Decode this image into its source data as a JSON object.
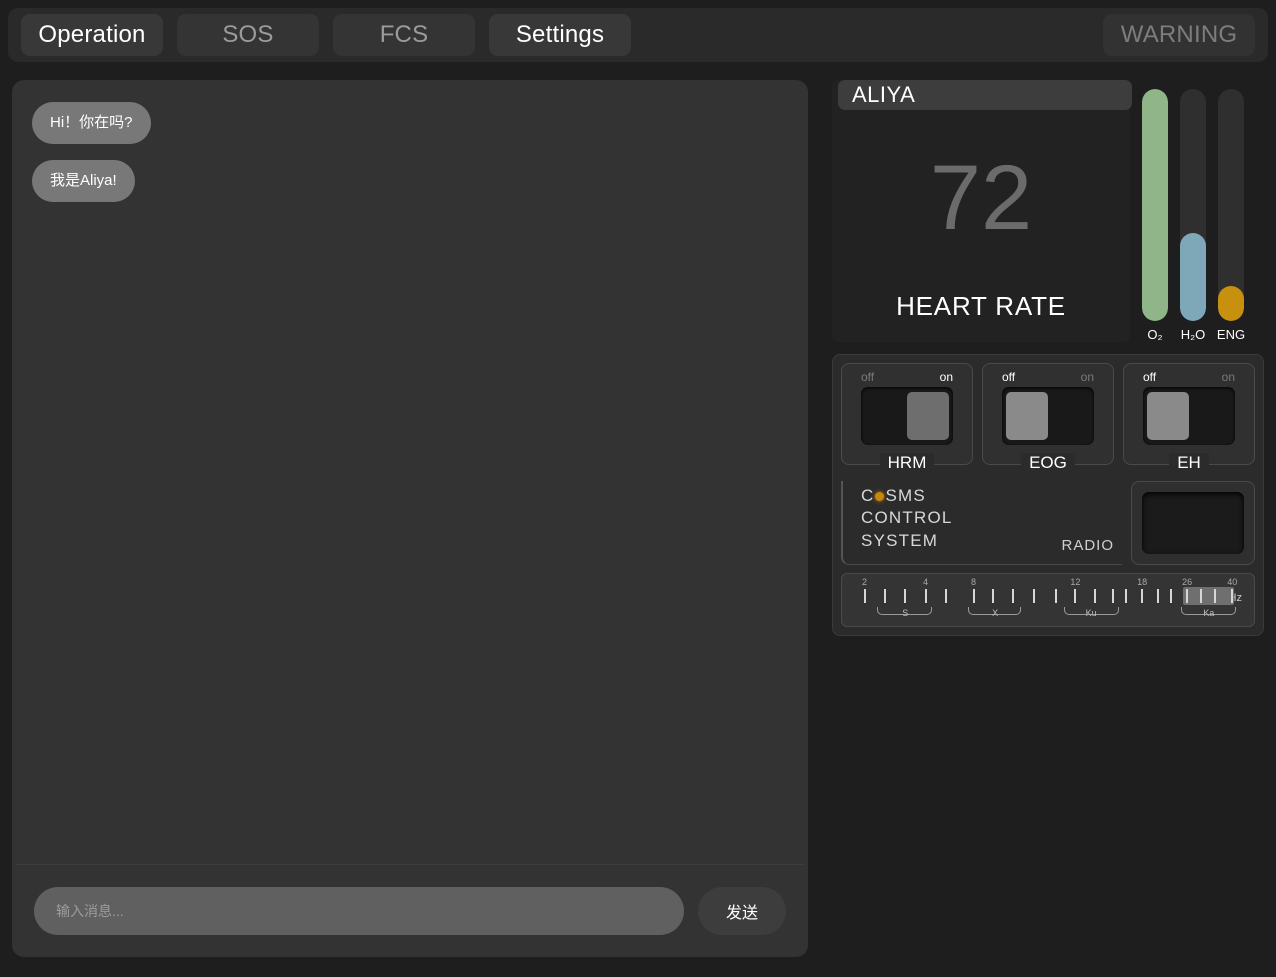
{
  "topbar": {
    "tabs": [
      {
        "label": "Operation",
        "state": "active"
      },
      {
        "label": "SOS",
        "state": "inactive"
      },
      {
        "label": "FCS",
        "state": "inactive"
      },
      {
        "label": "Settings",
        "state": "active"
      }
    ],
    "warning": {
      "label": "WARNING",
      "state": "inactive"
    }
  },
  "chat": {
    "messages": [
      {
        "text": "Hi！你在吗?",
        "side": "left"
      },
      {
        "text": "我是Aliya!",
        "side": "left"
      }
    ],
    "input": {
      "value": "",
      "placeholder": "输入消息..."
    },
    "send_label": "发送"
  },
  "vitals": {
    "name": "ALIYA",
    "heart_rate_value": "72",
    "heart_rate_label": "HEART RATE",
    "gauges": [
      {
        "id": "o2",
        "label": "O₂",
        "percent": 100,
        "color": "#8fb588"
      },
      {
        "id": "h2o",
        "label": "H₂O",
        "percent": 38,
        "color": "#7ea8b8"
      },
      {
        "id": "eng",
        "label": "ENG",
        "percent": 15,
        "color": "#c8900f"
      }
    ]
  },
  "control_panel": {
    "switches": [
      {
        "name": "HRM",
        "off_label": "off",
        "on_label": "on",
        "state": "on"
      },
      {
        "name": "EOG",
        "off_label": "off",
        "on_label": "on",
        "state": "off"
      },
      {
        "name": "EH",
        "off_label": "off",
        "on_label": "on",
        "state": "off"
      }
    ],
    "cosmos": {
      "line1_a": "C",
      "line1_b": "SM",
      "line1_c": "S",
      "line2": "CONTROL",
      "line3": "SYSTEM",
      "led_color": "#c8870f"
    },
    "radio_label": "RADIO",
    "frequency": {
      "unit": "GHz",
      "labeled_ticks": [
        {
          "value": "2",
          "pos": 3.2
        },
        {
          "value": "4",
          "pos": 18.8
        },
        {
          "value": "8",
          "pos": 31.0
        },
        {
          "value": "12",
          "pos": 57.0
        },
        {
          "value": "18",
          "pos": 74.0
        },
        {
          "value": "26",
          "pos": 85.5
        },
        {
          "value": "40",
          "pos": 97.0
        }
      ],
      "tick_positions": [
        3.2,
        8.4,
        13.6,
        18.8,
        24.0,
        31.0,
        36.0,
        41.0,
        46.5,
        52.0,
        57.0,
        62.0,
        66.5,
        70.0,
        74.0,
        78.0,
        81.5,
        85.5,
        89.0,
        92.5,
        97.0
      ],
      "bands": [
        {
          "name": "S",
          "start": 6.5,
          "end": 20.5,
          "center": 13.6
        },
        {
          "name": "X",
          "start": 29.5,
          "end": 43.0,
          "center": 36.5
        },
        {
          "name": "Ku",
          "start": 54.0,
          "end": 68.0,
          "center": 61.0
        },
        {
          "name": "Ka",
          "start": 84.0,
          "end": 98.0,
          "center": 91.0
        }
      ],
      "selection": {
        "start": 84.5,
        "end": 97.5
      }
    }
  }
}
